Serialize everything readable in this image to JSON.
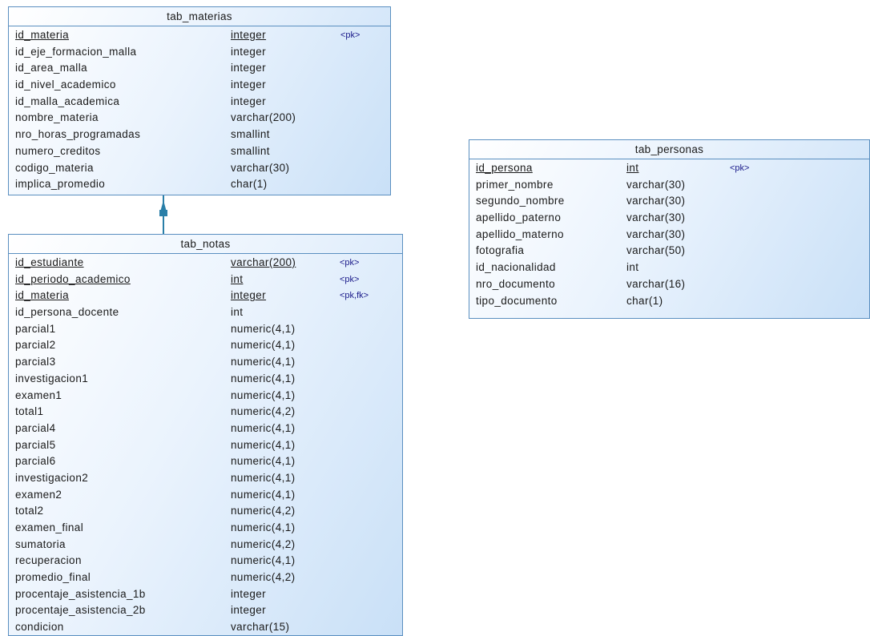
{
  "tab_materias": {
    "title": "tab_materias",
    "columns": [
      {
        "name": "id_materia",
        "type": "integer",
        "key": "<pk>"
      },
      {
        "name": "id_eje_formacion_malla",
        "type": "integer",
        "key": ""
      },
      {
        "name": "id_area_malla",
        "type": "integer",
        "key": ""
      },
      {
        "name": "id_nivel_academico",
        "type": "integer",
        "key": ""
      },
      {
        "name": "id_malla_academica",
        "type": "integer",
        "key": ""
      },
      {
        "name": "nombre_materia",
        "type": "varchar(200)",
        "key": ""
      },
      {
        "name": "nro_horas_programadas",
        "type": "smallint",
        "key": ""
      },
      {
        "name": "numero_creditos",
        "type": "smallint",
        "key": ""
      },
      {
        "name": "codigo_materia",
        "type": "varchar(30)",
        "key": ""
      },
      {
        "name": "implica_promedio",
        "type": "char(1)",
        "key": ""
      }
    ]
  },
  "tab_notas": {
    "title": "tab_notas",
    "columns": [
      {
        "name": "id_estudiante",
        "type": "varchar(200)",
        "key": "<pk>"
      },
      {
        "name": "id_periodo_academico",
        "type": "int",
        "key": "<pk>"
      },
      {
        "name": "id_materia",
        "type": "integer",
        "key": "<pk,fk>"
      },
      {
        "name": "id_persona_docente",
        "type": "int",
        "key": ""
      },
      {
        "name": "parcial1",
        "type": "numeric(4,1)",
        "key": ""
      },
      {
        "name": "parcial2",
        "type": "numeric(4,1)",
        "key": ""
      },
      {
        "name": "parcial3",
        "type": "numeric(4,1)",
        "key": ""
      },
      {
        "name": "investigacion1",
        "type": "numeric(4,1)",
        "key": ""
      },
      {
        "name": "examen1",
        "type": "numeric(4,1)",
        "key": ""
      },
      {
        "name": "total1",
        "type": "numeric(4,2)",
        "key": ""
      },
      {
        "name": "parcial4",
        "type": "numeric(4,1)",
        "key": ""
      },
      {
        "name": "parcial5",
        "type": "numeric(4,1)",
        "key": ""
      },
      {
        "name": "parcial6",
        "type": "numeric(4,1)",
        "key": ""
      },
      {
        "name": "investigacion2",
        "type": "numeric(4,1)",
        "key": ""
      },
      {
        "name": "examen2",
        "type": "numeric(4,1)",
        "key": ""
      },
      {
        "name": "total2",
        "type": "numeric(4,2)",
        "key": ""
      },
      {
        "name": "examen_final",
        "type": "numeric(4,1)",
        "key": ""
      },
      {
        "name": "sumatoria",
        "type": "numeric(4,2)",
        "key": ""
      },
      {
        "name": "recuperacion",
        "type": "numeric(4,1)",
        "key": ""
      },
      {
        "name": "promedio_final",
        "type": "numeric(4,2)",
        "key": ""
      },
      {
        "name": "procentaje_asistencia_1b",
        "type": "integer",
        "key": ""
      },
      {
        "name": "procentaje_asistencia_2b",
        "type": "integer",
        "key": ""
      },
      {
        "name": "condicion",
        "type": "varchar(15)",
        "key": ""
      }
    ]
  },
  "tab_personas": {
    "title": "tab_personas",
    "columns": [
      {
        "name": "id_persona",
        "type": "int",
        "key": "<pk>"
      },
      {
        "name": "primer_nombre",
        "type": "varchar(30)",
        "key": ""
      },
      {
        "name": "segundo_nombre",
        "type": "varchar(30)",
        "key": ""
      },
      {
        "name": "apellido_paterno",
        "type": "varchar(30)",
        "key": ""
      },
      {
        "name": "apellido_materno",
        "type": "varchar(30)",
        "key": ""
      },
      {
        "name": "fotografia",
        "type": "varchar(50)",
        "key": ""
      },
      {
        "name": "id_nacionalidad",
        "type": "int",
        "key": ""
      },
      {
        "name": "nro_documento",
        "type": "varchar(16)",
        "key": ""
      },
      {
        "name": "tipo_documento",
        "type": "char(1)",
        "key": ""
      }
    ]
  },
  "relationship": {
    "from": "tab_notas",
    "to": "tab_materias",
    "color": "#2a7fa8"
  }
}
